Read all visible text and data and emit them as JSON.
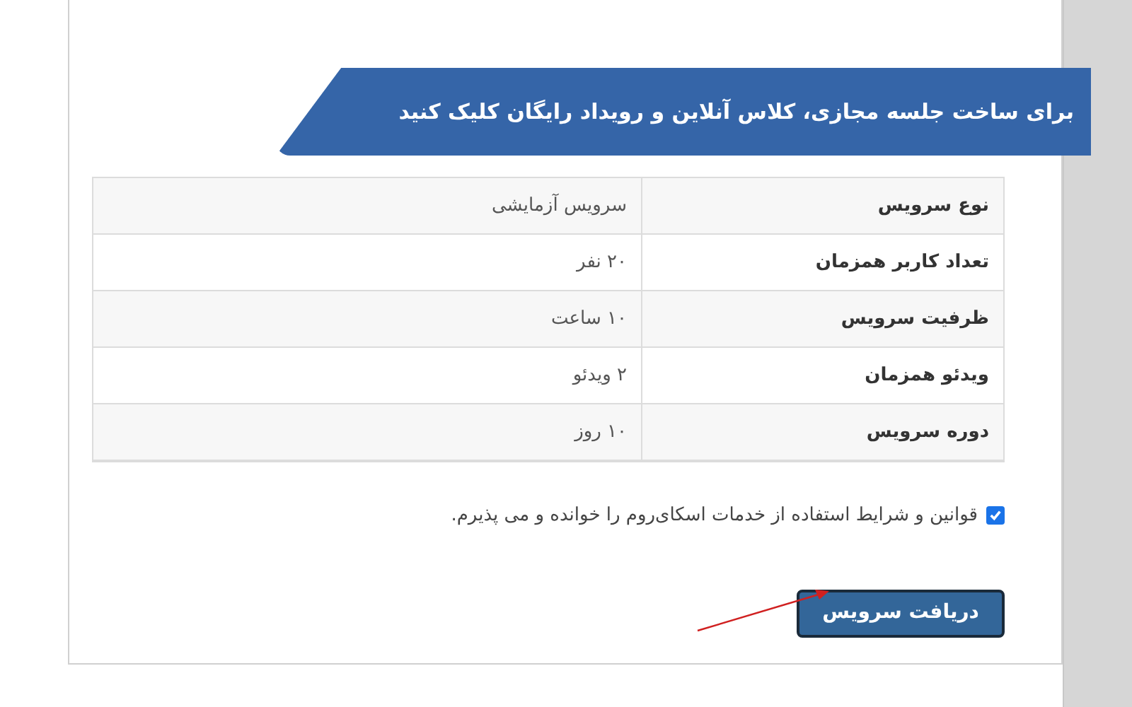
{
  "banner": {
    "text": "برای ساخت  جلسه مجازی، کلاس آنلاین و رویداد رایگان کلیک کنید"
  },
  "table": {
    "rows": [
      {
        "label": "نوع سرویس",
        "value": "سرویس آزمایشی"
      },
      {
        "label": "تعداد کاربر همزمان",
        "value": "۲۰ نفر"
      },
      {
        "label": "ظرفیت سرویس",
        "value": "۱۰ ساعت"
      },
      {
        "label": "ویدئو همزمان",
        "value": "۲ ویدئو"
      },
      {
        "label": "دوره سرویس",
        "value": "۱۰ روز"
      }
    ]
  },
  "terms": {
    "text": "قوانین و شرایط استفاده از خدمات اسکای‌روم را خوانده و می پذیرم.",
    "checked": true
  },
  "submit_button": {
    "label": "دریافت سرویس"
  }
}
